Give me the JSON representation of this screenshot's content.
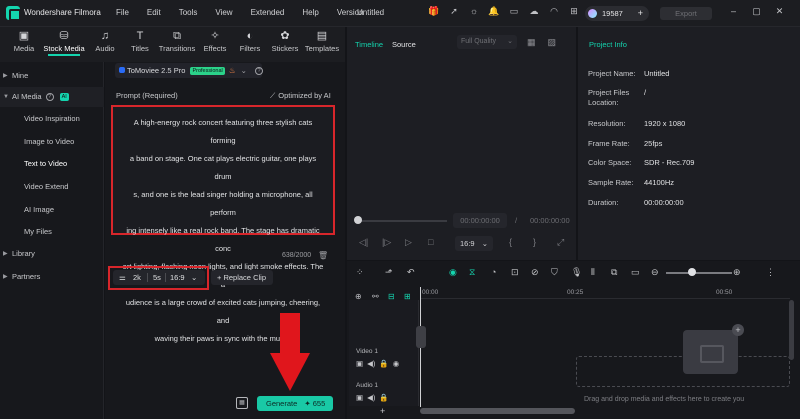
{
  "titlebar": {
    "app_name": "Wondershare Filmora",
    "menu": [
      "File",
      "Edit",
      "Tools",
      "View",
      "Extended",
      "Help",
      "Version"
    ],
    "document_title": "Untitled",
    "credits": "19587",
    "export_label": "Export"
  },
  "toolbar": {
    "tabs": [
      {
        "label": "Media",
        "icon": "media-icon"
      },
      {
        "label": "Stock Media",
        "icon": "stock-media-icon"
      },
      {
        "label": "Audio",
        "icon": "audio-icon"
      },
      {
        "label": "Titles",
        "icon": "titles-icon"
      },
      {
        "label": "Transitions",
        "icon": "transitions-icon"
      },
      {
        "label": "Effects",
        "icon": "effects-icon"
      },
      {
        "label": "Filters",
        "icon": "filters-icon"
      },
      {
        "label": "Stickers",
        "icon": "stickers-icon"
      },
      {
        "label": "Templates",
        "icon": "templates-icon"
      }
    ],
    "active_tab": "Stock Media"
  },
  "sidebar": {
    "mine": "Mine",
    "ai_media": "AI Media",
    "ai_badge": "AI",
    "items": [
      "Video Inspiration",
      "Image to Video",
      "Text to Video",
      "Video Extend",
      "AI Image",
      "My Files"
    ],
    "selected_item": "Text to Video",
    "library": "Library",
    "partners": "Partners"
  },
  "generator": {
    "model_name": "ToMoviee 2.5 Pro",
    "model_badge": "Professional",
    "prompt_label": "Prompt (Required)",
    "optimized_label": "Optimized by AI",
    "prompt_lines": [
      "A high-energy rock concert featuring three stylish cats forming",
      "a band on stage. One cat plays electric guitar, one plays drum",
      "s, and one is the lead singer holding a microphone, all perform",
      "ing intensely like a real rock band. The stage has dramatic conc",
      "ert lighting, flashing neon lights, and light smoke effects. The a",
      "udience is a large crowd of excited cats jumping, cheering, and",
      "waving their paws in sync with the music."
    ],
    "char_count": "638/2000",
    "resolution": "2k",
    "duration": "5s",
    "aspect_ratio": "16:9",
    "replace_clip_label": "+ Replace Clip",
    "generate_label": "Generate",
    "generate_cost": "655"
  },
  "preview": {
    "tab_timeline": "Timeline",
    "tab_source": "Source",
    "quality": "Full Quality",
    "current_time": "00:00:00:00",
    "separator": "/",
    "total_time": "00:00:00:00",
    "ratio": "16:9"
  },
  "project_info": {
    "header": "Project Info",
    "rows": [
      {
        "label": "Project Name:",
        "value": "Untitled"
      },
      {
        "label": "Project Files Location:",
        "value": "/"
      },
      {
        "label": "Resolution:",
        "value": "1920 x 1080"
      },
      {
        "label": "Frame Rate:",
        "value": "25fps"
      },
      {
        "label": "Color Space:",
        "value": "SDR - Rec.709"
      },
      {
        "label": "Sample Rate:",
        "value": "44100Hz"
      },
      {
        "label": "Duration:",
        "value": "00:00:00:00"
      }
    ]
  },
  "timeline": {
    "ruler": [
      "00:00",
      "00:25",
      "00:50"
    ],
    "video_track": "Video 1",
    "audio_track": "Audio 1",
    "drop_hint": "Drag and drop media and effects here to create you"
  },
  "colors": {
    "accent": "#14d4ae",
    "highlight_border": "#d8262b",
    "arrow": "#e0161c"
  }
}
